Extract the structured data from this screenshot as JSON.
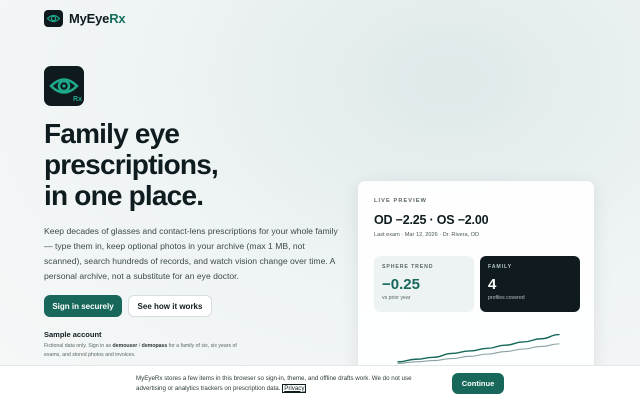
{
  "header": {
    "brand_prefix": "MyEye",
    "brand_suffix": "Rx"
  },
  "hero": {
    "logo_badge": "Rx",
    "headline": "Family eye\nprescriptions,\nin one place.",
    "lede": "Keep decades of glasses and contact-lens prescriptions for your whole family — type them in, keep optional photos in your archive (max 1 MB, not scanned), search hundreds of records, and watch vision change over time. A personal archive, not a substitute for an eye doctor.",
    "primary_cta": "Sign in securely",
    "secondary_cta": "See how it works"
  },
  "sample": {
    "title": "Sample account",
    "text_before": "Fictional data only. Sign in as ",
    "username": "demouser",
    "separator": " / ",
    "password": "demopass",
    "text_after": " for a family of six, six years of exams, and stored photos and invoices."
  },
  "preview": {
    "label": "LIVE PREVIEW",
    "rx": "OD −2.25 · OS −2.00",
    "meta": "Last exam · Mar 12, 2026 · Dr. Rivera, OD",
    "sphere": {
      "caption": "SPHERE TREND",
      "value": "−0.25",
      "sub": "vs prior year"
    },
    "family": {
      "caption": "FAMILY",
      "value": "4",
      "sub": "profiles covered"
    },
    "chart_series": [
      {
        "name": "",
        "color": "#17685a",
        "values": [
          0.1,
          0.18,
          0.24,
          0.36,
          0.44,
          0.52,
          0.62,
          0.72,
          0.82,
          0.95
        ]
      },
      {
        "name": "",
        "color": "#8aa0a3",
        "values": [
          0.05,
          0.1,
          0.14,
          0.2,
          0.27,
          0.34,
          0.42,
          0.5,
          0.58,
          0.66
        ]
      }
    ]
  },
  "cookie": {
    "text": "MyEyeRx stores a few items in this browser so sign-in, theme, and offline drafts work. We do not use advertising or analytics trackers on prescription data.",
    "link": "Privacy",
    "accept": "Continue"
  },
  "colors": {
    "accent": "#17685a",
    "dark": "#0f1b1e"
  },
  "icons": {
    "logo": "eye-icon"
  }
}
